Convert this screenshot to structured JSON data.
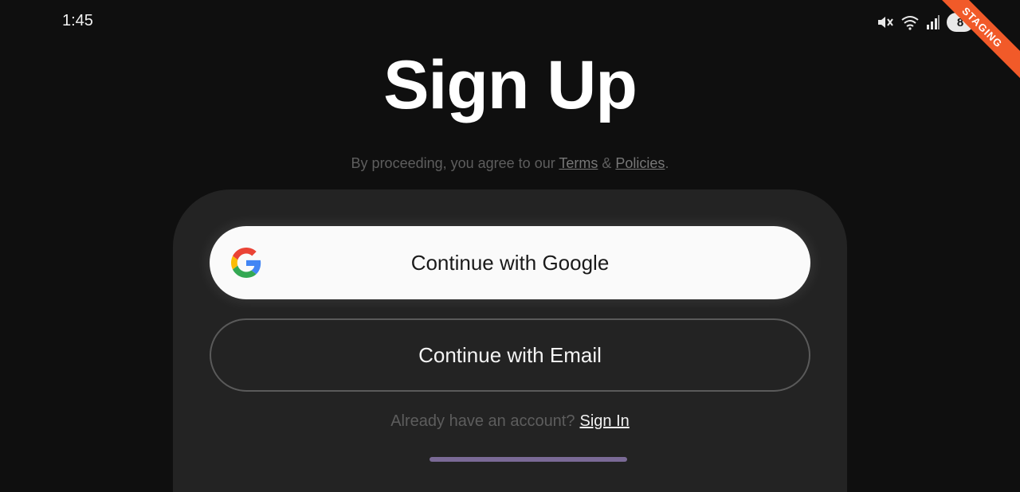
{
  "status_bar": {
    "time": "1:45",
    "battery": "8",
    "icons": [
      "mute-icon",
      "wifi-icon",
      "signal-icon"
    ]
  },
  "ribbon": {
    "label": "STAGING",
    "color": "#f15a29"
  },
  "title": "Sign Up",
  "agreement": {
    "prefix": "By proceeding, you agree to our ",
    "terms": "Terms",
    "amp": " & ",
    "policies": "Policies",
    "suffix": "."
  },
  "buttons": {
    "google": "Continue with Google",
    "email": "Continue with Email"
  },
  "signin": {
    "prompt": "Already have an account?",
    "link": "Sign In"
  },
  "colors": {
    "background": "#0f0f0f",
    "sheet": "#232323",
    "accent_indicator": "#7a6a96"
  }
}
